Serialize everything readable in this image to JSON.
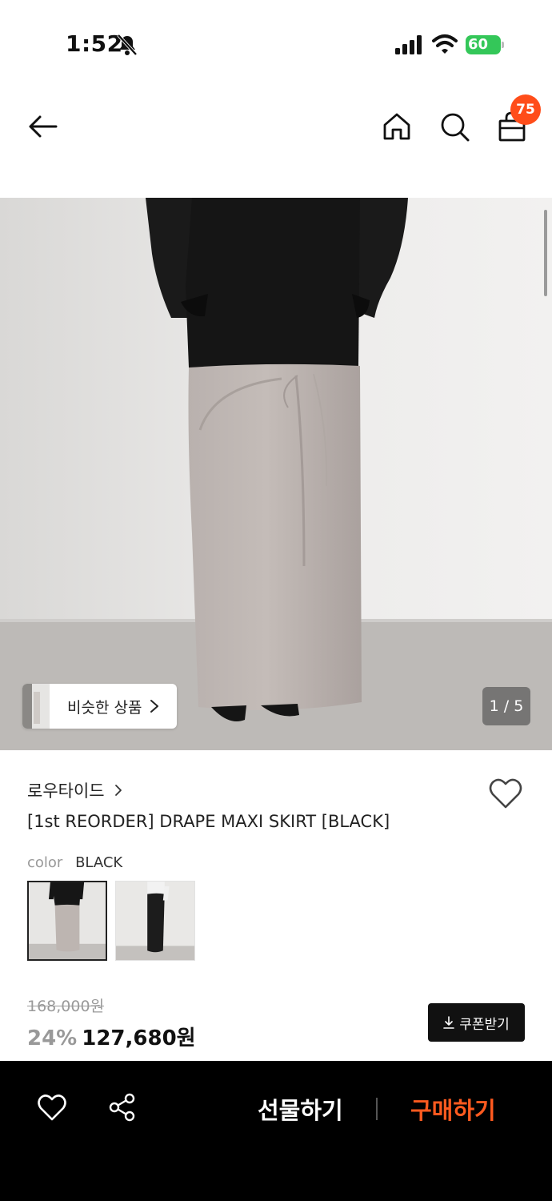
{
  "status_bar": {
    "time": "1:52",
    "battery": "60",
    "icons": [
      "bell-slash-icon",
      "signal-icon",
      "wifi-icon",
      "battery-charging-icon"
    ]
  },
  "header": {
    "icons": [
      "back-arrow-icon",
      "home-icon",
      "search-icon",
      "shopping-bag-icon"
    ],
    "cart_count": "75"
  },
  "gallery": {
    "similar_label": "비슷한 상품",
    "page_indicator": "1 / 5"
  },
  "product": {
    "brand": "로우타이드",
    "title": "[1st REORDER] DRAPE MAXI SKIRT [BLACK]",
    "option_label": "color",
    "option_value": "BLACK",
    "swatches": [
      "greige-skirt-thumbnail",
      "black-skirt-thumbnail"
    ],
    "original_price": "168,000원",
    "discount_rate": "24%",
    "sale_price": "127,680원",
    "coupon_label": "쿠폰받기"
  },
  "bottom_bar": {
    "gift_label": "선물하기",
    "buy_label": "구매하기",
    "icons": [
      "heart-outline-icon",
      "share-icon"
    ]
  },
  "colors": {
    "accent": "#ff5a1f",
    "badge": "#ff4d1a",
    "battery": "#34c759",
    "bottom_bar": "#000000"
  }
}
